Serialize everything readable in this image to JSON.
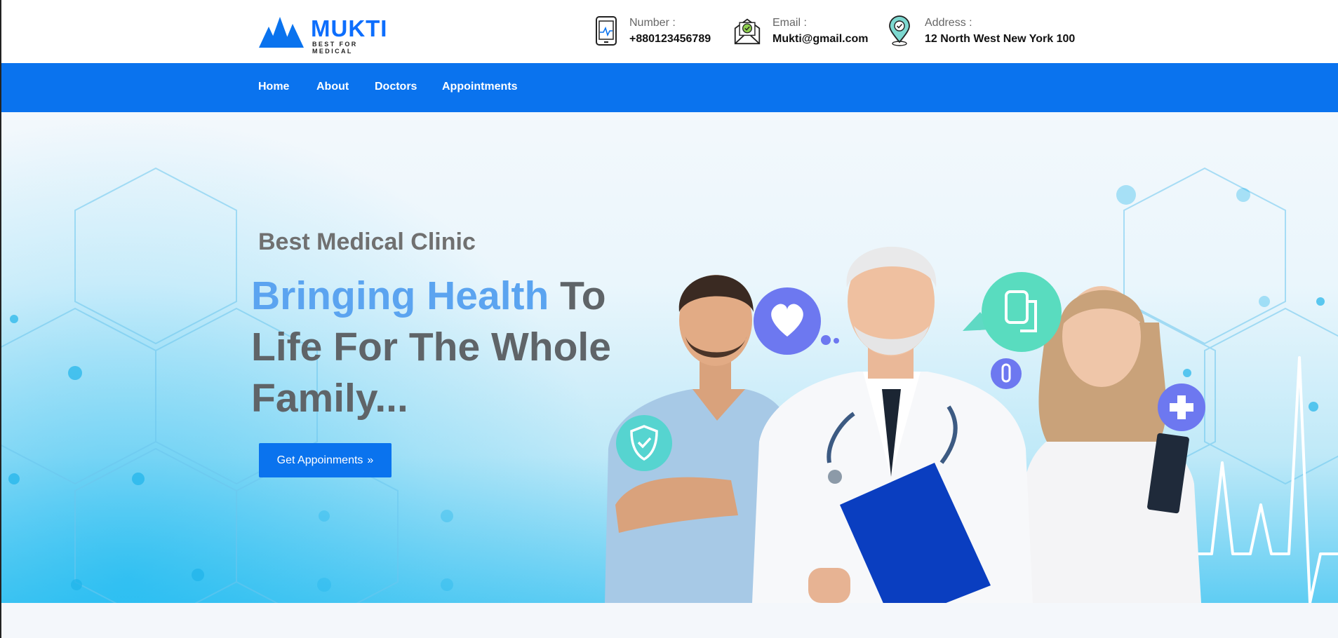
{
  "brand": {
    "name": "MUKTI",
    "tagline": "BEST FOR MEDICAL"
  },
  "contacts": {
    "number": {
      "label": "Number :",
      "value": "+880123456789",
      "icon": "phone-tablet-icon"
    },
    "email": {
      "label": "Email :",
      "value": "Mukti@gmail.com",
      "icon": "envelope-check-icon"
    },
    "address": {
      "label": "Address :",
      "value": "12 North West New York 100",
      "icon": "location-pin-icon"
    }
  },
  "nav": {
    "home": "Home",
    "about": "About",
    "doctors": "Doctors",
    "appointments": "Appointments"
  },
  "hero": {
    "subheading": "Best Medical Clinic",
    "headline_highlight": "Bringing Health",
    "headline_rest": " To Life For The Whole Family...",
    "cta_label": "Get Appoinments",
    "cta_icon": "double-chevron-right-icon"
  },
  "colors": {
    "primary": "#0a73ee",
    "highlight": "#5ba4f0",
    "heading_gray": "#5f6468"
  }
}
